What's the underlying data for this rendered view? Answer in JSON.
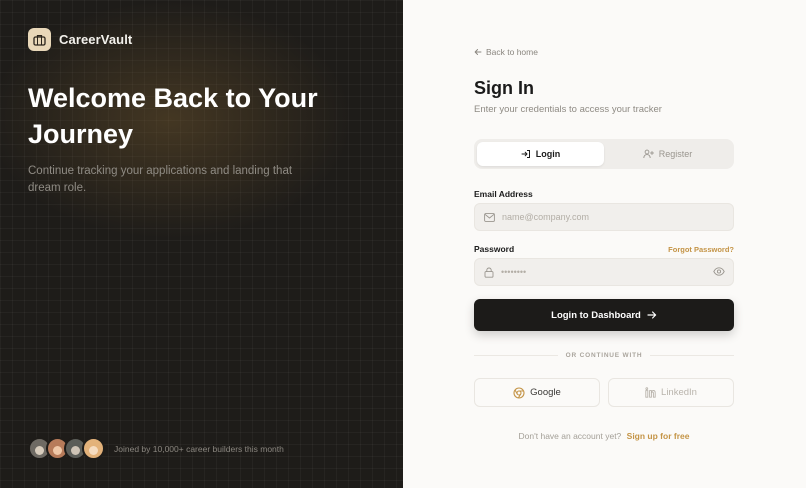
{
  "brand": {
    "name": "CareerVault",
    "logo_icon": "briefcase-icon"
  },
  "hero": {
    "title": "Welcome Back to Your Journey",
    "subtitle": "Continue tracking your applications and landing that dream role."
  },
  "social_proof": {
    "text": "Joined by 10,000+ career builders this month",
    "avatars": [
      {
        "bg": "#6e6a63",
        "head": "#d8cdbd"
      },
      {
        "bg": "#b77b5a",
        "head": "#f0c8a8"
      },
      {
        "bg": "#5b5d58",
        "head": "#cfc4b6"
      },
      {
        "bg": "#e3b27a",
        "head": "#f6dcc0"
      }
    ]
  },
  "form": {
    "back_link": "Back to home",
    "title": "Sign In",
    "subtitle": "Enter your credentials to access your tracker",
    "tabs": [
      {
        "label": "Login",
        "icon": "login-icon",
        "active": true
      },
      {
        "label": "Register",
        "icon": "add-user-icon",
        "active": false
      }
    ],
    "email": {
      "label": "Email Address",
      "placeholder": "name@company.com",
      "icon": "mail-icon"
    },
    "password": {
      "label": "Password",
      "placeholder": "••••••••",
      "icon": "lock-icon",
      "forgot": "Forgot Password?"
    },
    "submit_label": "Login to Dashboard",
    "divider": "OR CONTINUE WITH",
    "oauth": [
      {
        "label": "Google",
        "icon": "google-icon"
      },
      {
        "label": "LinkedIn",
        "icon": "linkedin-icon"
      }
    ],
    "signup_prompt": "Don't have an account yet?",
    "signup_link": "Sign up for free"
  },
  "colors": {
    "left_bg": "#1e1c19",
    "accent": "#c49446",
    "primary_button": "#1c1b19",
    "right_bg": "#fbfaf8"
  }
}
